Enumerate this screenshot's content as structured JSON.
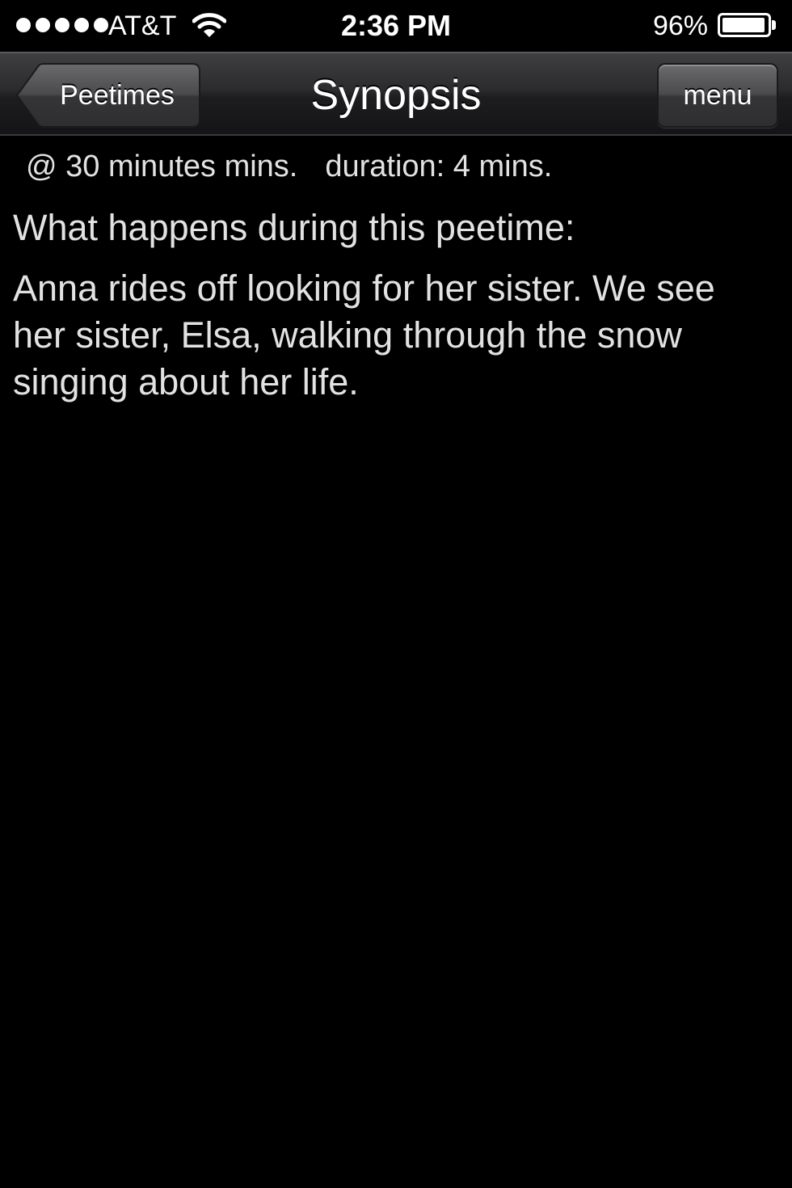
{
  "status_bar": {
    "carrier": "AT&T",
    "time": "2:36 PM",
    "battery_percent": "96%",
    "battery_level": 0.96,
    "signal_icon": "signal-dots-icon",
    "wifi_icon": "wifi-icon",
    "battery_icon": "battery-icon"
  },
  "nav_bar": {
    "back_label": "Peetimes",
    "title": "Synopsis",
    "menu_label": "menu"
  },
  "content": {
    "start_time": "@ 30 minutes mins.",
    "duration": "duration: 4 mins.",
    "question": "What happens during this peetime:",
    "synopsis": "Anna rides off looking for her sister. We see her sister, Elsa, walking through the snow singing about her life."
  }
}
